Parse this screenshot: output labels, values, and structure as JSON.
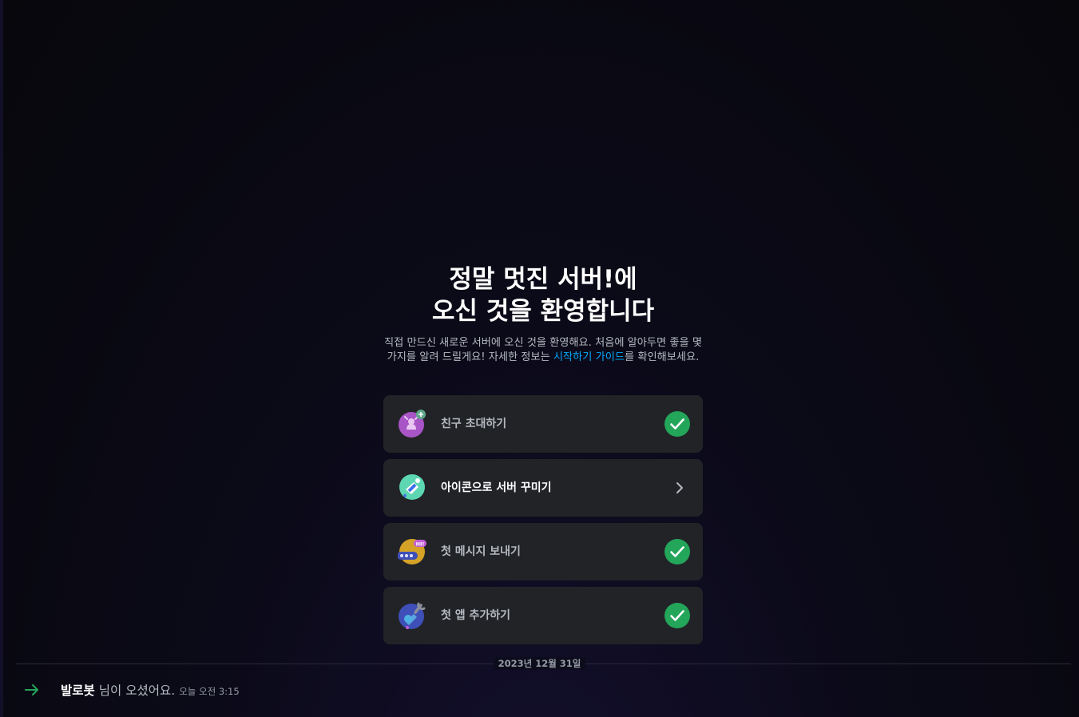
{
  "welcome": {
    "title_line1": "정말 멋진 서버!에",
    "title_line2": "오신 것을 환영합니다",
    "desc_part1": "직접 만드신 새로운 서버에 오신 것을 환영해요. 처음에 알아두면 좋을 몇 가지를 알려    드릴게요! 자세한 정보는 ",
    "desc_link": "시작하기 가이드",
    "desc_part2": "를 확인해보세요."
  },
  "cards": [
    {
      "label": "친구 초대하기",
      "icon": "invite-friends-icon",
      "status": "completed",
      "color": "#a855c7"
    },
    {
      "label": "아이콘으로 서버 꾸미기",
      "icon": "personalize-server-icon",
      "status": "pending",
      "color": "#5dd6b2"
    },
    {
      "label": "첫 메시지 보내기",
      "icon": "send-message-icon",
      "status": "completed",
      "color": "#d4a227"
    },
    {
      "label": "첫 앱 추가하기",
      "icon": "add-app-icon",
      "status": "completed",
      "color": "#3f4fb8"
    }
  ],
  "divider": {
    "date": "2023년 12월 31일"
  },
  "message": {
    "user": "발로봇",
    "text": "님이 오셨어요.",
    "time": "오늘 오전 3:15"
  },
  "colors": {
    "check_green": "#23a55a",
    "link_blue": "#00a8fc",
    "card_bg": "#222327"
  }
}
